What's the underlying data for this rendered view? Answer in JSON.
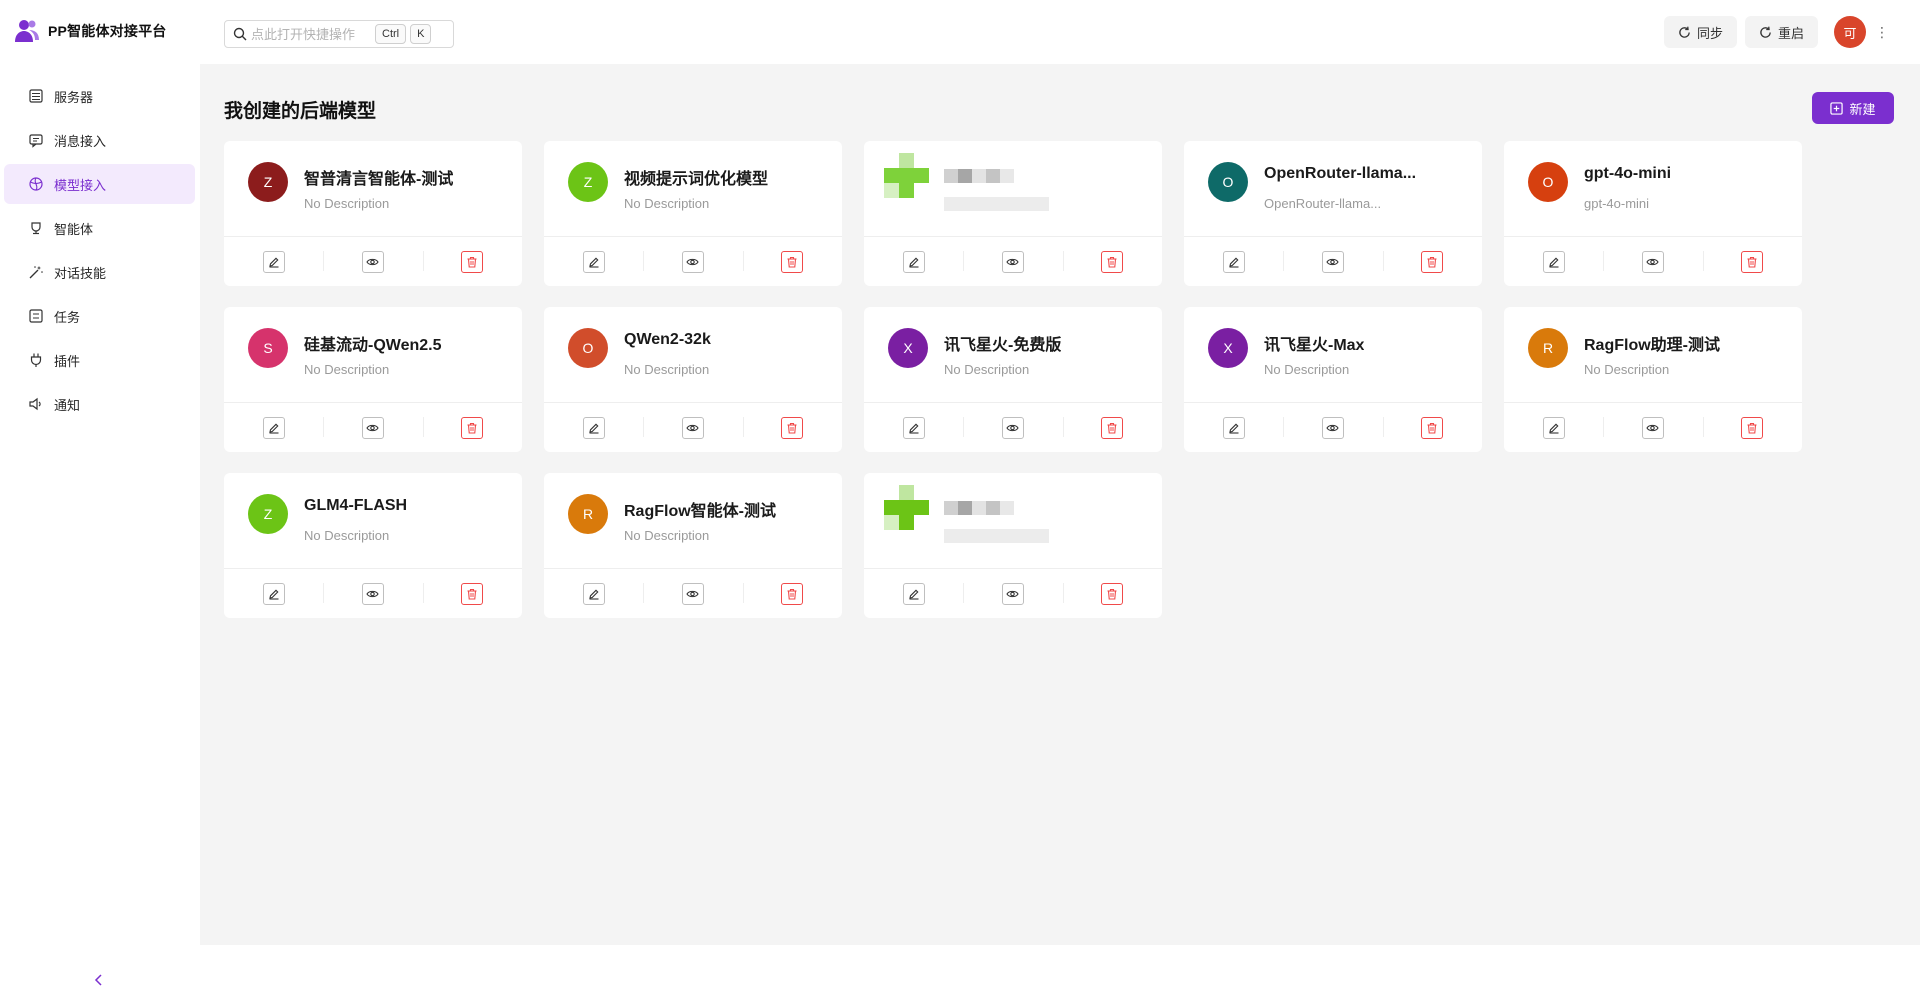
{
  "app": {
    "title": "PP智能体对接平台"
  },
  "search": {
    "placeholder": "点此打开快捷操作",
    "key1": "Ctrl",
    "key2": "K"
  },
  "top_actions": {
    "sync_label": "同步",
    "restart_label": "重启",
    "avatar_text": "可"
  },
  "sidebar": {
    "items": [
      {
        "label": "服务器",
        "icon": "server-icon"
      },
      {
        "label": "消息接入",
        "icon": "message-icon"
      },
      {
        "label": "模型接入",
        "icon": "model-icon",
        "active": true
      },
      {
        "label": "智能体",
        "icon": "agent-icon"
      },
      {
        "label": "对话技能",
        "icon": "skill-icon"
      },
      {
        "label": "任务",
        "icon": "task-icon"
      },
      {
        "label": "插件",
        "icon": "plugin-icon"
      },
      {
        "label": "通知",
        "icon": "notify-icon"
      }
    ],
    "collapse_icon": "chevron-left-icon"
  },
  "main": {
    "title": "我创建的后端模型",
    "new_label": "新建",
    "cards": [
      {
        "name": "智普清言智能体-测试",
        "desc": "No Description",
        "letter": "Z",
        "color": "#8c1c1c"
      },
      {
        "name": "视频提示词优化模型",
        "desc": "No Description",
        "letter": "Z",
        "color": "#6cc416"
      },
      {
        "name": "",
        "desc": "",
        "letter": "",
        "color": "#7ed23a",
        "obscured": true
      },
      {
        "name": "OpenRouter-llama...",
        "desc": "OpenRouter-llama...",
        "letter": "O",
        "color": "#0e6a68"
      },
      {
        "name": "gpt-4o-mini",
        "desc": "gpt-4o-mini",
        "letter": "O",
        "color": "#d6400f"
      },
      {
        "name": "硅基流动-QWen2.5",
        "desc": "No Description",
        "letter": "S",
        "color": "#d6336c"
      },
      {
        "name": "QWen2-32k",
        "desc": "No Description",
        "letter": "O",
        "color": "#d14d2b"
      },
      {
        "name": "讯飞星火-免费版",
        "desc": "No Description",
        "letter": "X",
        "color": "#7a1fa2"
      },
      {
        "name": "讯飞星火-Max",
        "desc": "No Description",
        "letter": "X",
        "color": "#7a1fa2"
      },
      {
        "name": "RagFlow助理-测试",
        "desc": "No Description",
        "letter": "R",
        "color": "#d97a0b"
      },
      {
        "name": "GLM4-FLASH",
        "desc": "No Description",
        "letter": "Z",
        "color": "#6cc416"
      },
      {
        "name": "RagFlow智能体-测试",
        "desc": "No Description",
        "letter": "R",
        "color": "#d97a0b"
      },
      {
        "name": "",
        "desc": "",
        "letter": "",
        "color": "#6cc416",
        "obscured": true
      }
    ]
  },
  "colors": {
    "accent": "#7b2fcf",
    "danger": "#f04a4a",
    "bg": "#f4f4f4"
  }
}
